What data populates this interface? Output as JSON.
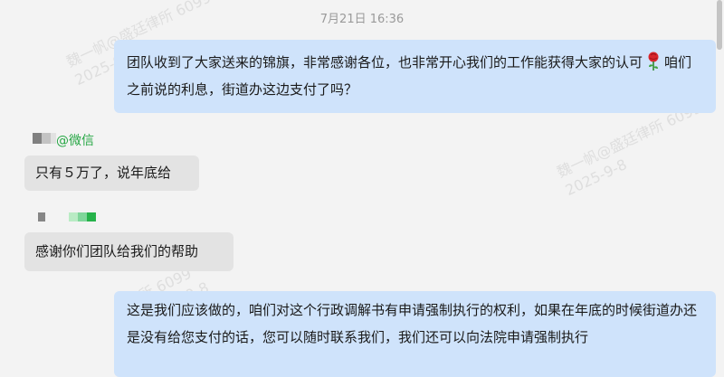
{
  "timestamp": "7月21日 16:36",
  "messages": [
    {
      "direction": "out",
      "text_before_emoji": "团队收到了大家送来的锦旗，非常感谢各位，也非常开心我们的工作能获得大家的认可",
      "emoji": "rose-icon",
      "text_after_emoji": "咱们之前说的利息，街道办这边支付了吗？"
    },
    {
      "direction": "in",
      "sender_suffix": "@微信",
      "text": "只有５万了，说年底给"
    },
    {
      "direction": "in",
      "text": "感谢你们团队给我们的帮助"
    },
    {
      "direction": "out",
      "text": "这是我们应该做的，咱们对这个行政调解书有申请强制执行的权利，如果在年底的时候街道办还是没有给您支付的话，您可以随时联系我们，我们还可以向法院申请强制执行"
    }
  ],
  "watermark": {
    "line1": "魏一帆@盛廷律所 6099",
    "line2": "2025-9-8",
    "line1_partial": "所 6099",
    "line2_partial": "2025-9-8"
  },
  "colors": {
    "background": "#f3f3f3",
    "outgoing_bubble": "#cfe3fb",
    "incoming_bubble": "#e3e3e3",
    "sender_tag": "#27a745",
    "timestamp": "#9a9a9a"
  }
}
